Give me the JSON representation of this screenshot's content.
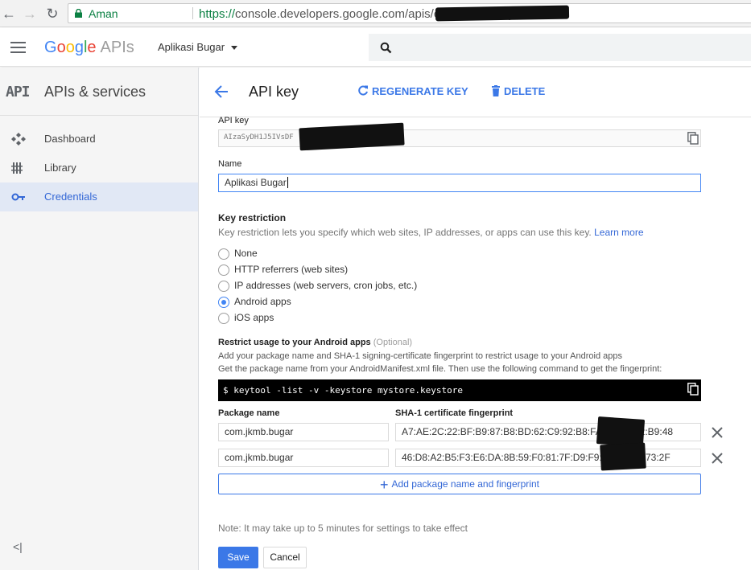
{
  "browser": {
    "secure_label": "Aman",
    "url_scheme": "https://",
    "url_rest": "console.developers.google.com/apis/credentials/key/"
  },
  "header": {
    "logo_letters": [
      "G",
      "o",
      "o",
      "g",
      "l",
      "e"
    ],
    "logo_suffix": "APIs",
    "project_name": "Aplikasi Bugar"
  },
  "sidebar": {
    "title_glyph": "API",
    "title": "APIs & services",
    "items": [
      {
        "label": "Dashboard",
        "icon": "dashboard-icon",
        "active": false
      },
      {
        "label": "Library",
        "icon": "library-icon",
        "active": false
      },
      {
        "label": "Credentials",
        "icon": "key-icon",
        "active": true
      }
    ],
    "collapse_glyph": "<|"
  },
  "page": {
    "title": "API key",
    "regenerate_label": "REGENERATE KEY",
    "delete_label": "DELETE"
  },
  "form": {
    "api_key_label": "API key",
    "api_key_value_visible": "AIzaSyDH1J5IVsDF",
    "name_label": "Name",
    "name_value": "Aplikasi Bugar",
    "restriction_title": "Key restriction",
    "restriction_help": "Key restriction lets you specify which web sites, IP addresses, or apps can use this key.",
    "learn_more": "Learn more",
    "restriction_options": [
      {
        "label": "None",
        "checked": false
      },
      {
        "label": "HTTP referrers (web sites)",
        "checked": false
      },
      {
        "label": "IP addresses (web servers, cron jobs, etc.)",
        "checked": false
      },
      {
        "label": "Android apps",
        "checked": true
      },
      {
        "label": "iOS apps",
        "checked": false
      }
    ],
    "android_title": "Restrict usage to your Android apps",
    "android_optional": "(Optional)",
    "android_help_1": "Add your package name and SHA-1 signing-certificate fingerprint to restrict usage to your Android apps",
    "android_help_2": "Get the package name from your AndroidManifest.xml file. Then use the following command to get the fingerprint:",
    "command": "$ keytool -list -v -keystore mystore.keystore",
    "package_header": "Package name",
    "fingerprint_header": "SHA-1 certificate fingerprint",
    "rows": [
      {
        "package": "com.jkmb.bugar",
        "fingerprint": "A7:AE:2C:22:BF:B9:87:B8:BD:62:C9:92:B8:FA:",
        "fingerprint_tail": "82:B9:48"
      },
      {
        "package": "com.jkmb.bugar",
        "fingerprint": "46:D8:A2:B5:F3:E6:DA:8B:59:F0:81:7F:D9:F9:B",
        "fingerprint_tail": "73:2F"
      }
    ],
    "add_label": "Add package name and fingerprint",
    "note": "Note: It may take up to 5 minutes for settings to take effect",
    "save_label": "Save",
    "cancel_label": "Cancel"
  },
  "colors": {
    "accent": "#3b78e7",
    "link": "#3367d6",
    "secure": "#0b8043",
    "sidebar_active": "#e1e8f5"
  }
}
